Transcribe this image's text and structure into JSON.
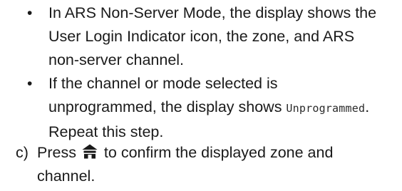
{
  "bullets": [
    {
      "marker": "•",
      "text": "In ARS Non-Server Mode, the display shows the User Login Indicator icon, the zone, and ARS non-server channel."
    },
    {
      "marker": "•",
      "text_before": "If the channel or mode selected is unprogrammed, the display shows ",
      "display_text": "Unprogrammed",
      "text_after": ". Repeat this step."
    }
  ],
  "step": {
    "label": "c)",
    "text_before": "Press ",
    "icon": "home-icon",
    "text_after": " to confirm the displayed zone and channel."
  }
}
